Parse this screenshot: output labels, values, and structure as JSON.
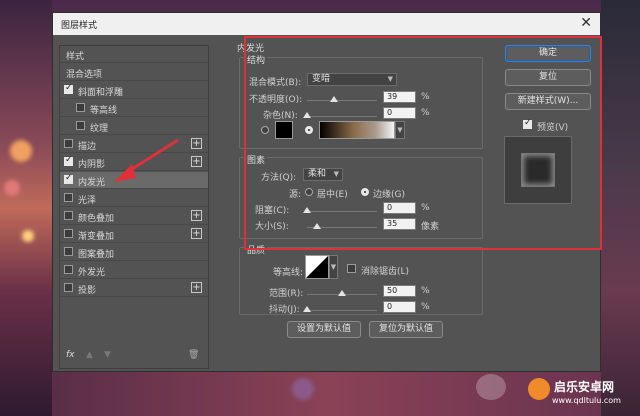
{
  "dialog": {
    "title": "图层样式",
    "close_glyph": "✕"
  },
  "styles_list": {
    "header": "样式",
    "blend_options": "混合选项",
    "items": [
      {
        "label": "斜面和浮雕",
        "checked": true,
        "plus": false
      },
      {
        "label": "等高线",
        "checked": false,
        "plus": false,
        "indent": true
      },
      {
        "label": "纹理",
        "checked": false,
        "plus": false,
        "indent": true
      },
      {
        "label": "描边",
        "checked": false,
        "plus": true
      },
      {
        "label": "内阴影",
        "checked": true,
        "plus": true
      },
      {
        "label": "内发光",
        "checked": true,
        "plus": false,
        "selected": true
      },
      {
        "label": "光泽",
        "checked": false,
        "plus": false
      },
      {
        "label": "颜色叠加",
        "checked": false,
        "plus": true
      },
      {
        "label": "渐变叠加",
        "checked": false,
        "plus": true
      },
      {
        "label": "图案叠加",
        "checked": false,
        "plus": false
      },
      {
        "label": "外发光",
        "checked": false,
        "plus": false
      },
      {
        "label": "投影",
        "checked": false,
        "plus": true
      }
    ],
    "footer_fx": "fx",
    "plus_glyph": "+",
    "up_glyph": "▲",
    "down_glyph": "▼",
    "trash_glyph": "🗑"
  },
  "inner_glow": {
    "title": "内发光",
    "structure": {
      "title": "结构",
      "blend_mode_label": "混合模式(B):",
      "blend_mode_value": "变暗",
      "opacity_label": "不透明度(O):",
      "opacity_value": "39",
      "opacity_fraction": 0.39,
      "noise_label": "杂色(N):",
      "noise_value": "0",
      "noise_fraction": 0.0,
      "percent": "%"
    },
    "elements": {
      "title": "图素",
      "method_label": "方法(Q):",
      "method_value": "柔和",
      "source_label": "源:",
      "source_center": "居中(E)",
      "source_edge": "边缘(G)",
      "choke_label": "阻塞(C):",
      "choke_value": "0",
      "choke_fraction": 0.0,
      "size_label": "大小(S):",
      "size_value": "35",
      "size_fraction": 0.14,
      "size_unit": "像素",
      "percent": "%"
    },
    "quality": {
      "title": "品质",
      "contour_label": "等高线:",
      "antialias_label": "消除锯齿(L)",
      "range_label": "范围(R):",
      "range_value": "50",
      "range_fraction": 0.5,
      "jitter_label": "抖动(J):",
      "jitter_value": "0",
      "jitter_fraction": 0.0,
      "percent": "%"
    },
    "set_default": "设置为默认值",
    "reset_default": "复位为默认值"
  },
  "buttons": {
    "ok": "确定",
    "reset": "复位",
    "new_style": "新建样式(W)...",
    "preview_label": "预览(V)",
    "preview_checked": true
  },
  "watermark": {
    "brand": "启乐安卓网",
    "url": "www.qdltulu.com"
  },
  "colors": {
    "highlight_box": "#e0303a",
    "primary_border": "#3b7fd0"
  }
}
